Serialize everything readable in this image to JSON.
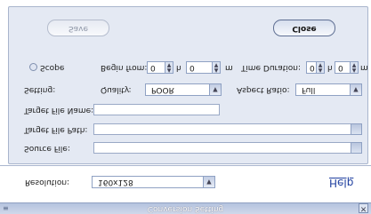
{
  "window": {
    "title": "Conversion Setting",
    "close_glyph": "×",
    "grip_glyph": "≡"
  },
  "resolution": {
    "label": "Resolution:",
    "value": "160x128"
  },
  "help_label": "Help",
  "source_file": {
    "label": "Source File:",
    "value": ""
  },
  "target_path": {
    "label": "Target File Path:",
    "value": ""
  },
  "target_name": {
    "label": "Target File Name:",
    "value": ""
  },
  "setting": {
    "label": "Setting:",
    "quality_label": "Quality:",
    "quality_value": "POOR",
    "aspect_label": "Aspect Ratio:",
    "aspect_value": "Full"
  },
  "scope": {
    "label": "Scope",
    "begin_label": "Begin from:",
    "begin_hours": "0",
    "h_unit": "h",
    "begin_minutes": "0",
    "m_unit": "m",
    "duration_label": "Time Duration:",
    "duration_hours": "0",
    "duration_minutes": "0"
  },
  "buttons": {
    "save_label": "Save",
    "close_label": "Close"
  }
}
